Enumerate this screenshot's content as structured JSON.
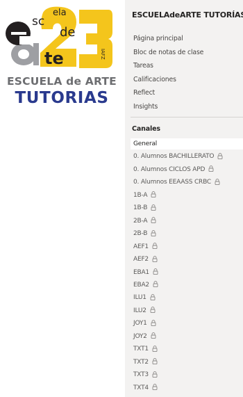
{
  "logo": {
    "line1": "ESCUELA de ARTE",
    "line2": "TUTORIAS",
    "colors": {
      "yellow": "#f4c51c",
      "dark": "#231f20",
      "gray": "#9e9fa3",
      "navy": "#2a3a8e"
    },
    "lettering": "escuela de arte 23"
  },
  "team": {
    "title": "ESCUELAdeARTE TUTORÍAS"
  },
  "nav": [
    {
      "label": "Página principal"
    },
    {
      "label": "Bloc de notas de clase"
    },
    {
      "label": "Tareas"
    },
    {
      "label": "Calificaciones"
    },
    {
      "label": "Reflect"
    },
    {
      "label": "Insights"
    }
  ],
  "channels_section": {
    "title": "Canales"
  },
  "channels": [
    {
      "label": "General",
      "locked": false,
      "selected": true
    },
    {
      "label": "0. Alumnos BACHILLERATO",
      "locked": true
    },
    {
      "label": "0. Alumnos CICLOS APD",
      "locked": true
    },
    {
      "label": "0. Alumnos EEAASS CRBC",
      "locked": true
    },
    {
      "label": "1B-A",
      "locked": true
    },
    {
      "label": "1B-B",
      "locked": true
    },
    {
      "label": "2B-A",
      "locked": true
    },
    {
      "label": "2B-B",
      "locked": true
    },
    {
      "label": "AEF1",
      "locked": true
    },
    {
      "label": "AEF2",
      "locked": true
    },
    {
      "label": "EBA1",
      "locked": true
    },
    {
      "label": "EBA2",
      "locked": true
    },
    {
      "label": "ILU1",
      "locked": true
    },
    {
      "label": "ILU2",
      "locked": true
    },
    {
      "label": "JOY1",
      "locked": true
    },
    {
      "label": "JOY2",
      "locked": true
    },
    {
      "label": "TXT1",
      "locked": true
    },
    {
      "label": "TXT2",
      "locked": true
    },
    {
      "label": "TXT3",
      "locked": true
    },
    {
      "label": "TXT4",
      "locked": true
    }
  ],
  "icons": {
    "lock": "lock-icon"
  }
}
